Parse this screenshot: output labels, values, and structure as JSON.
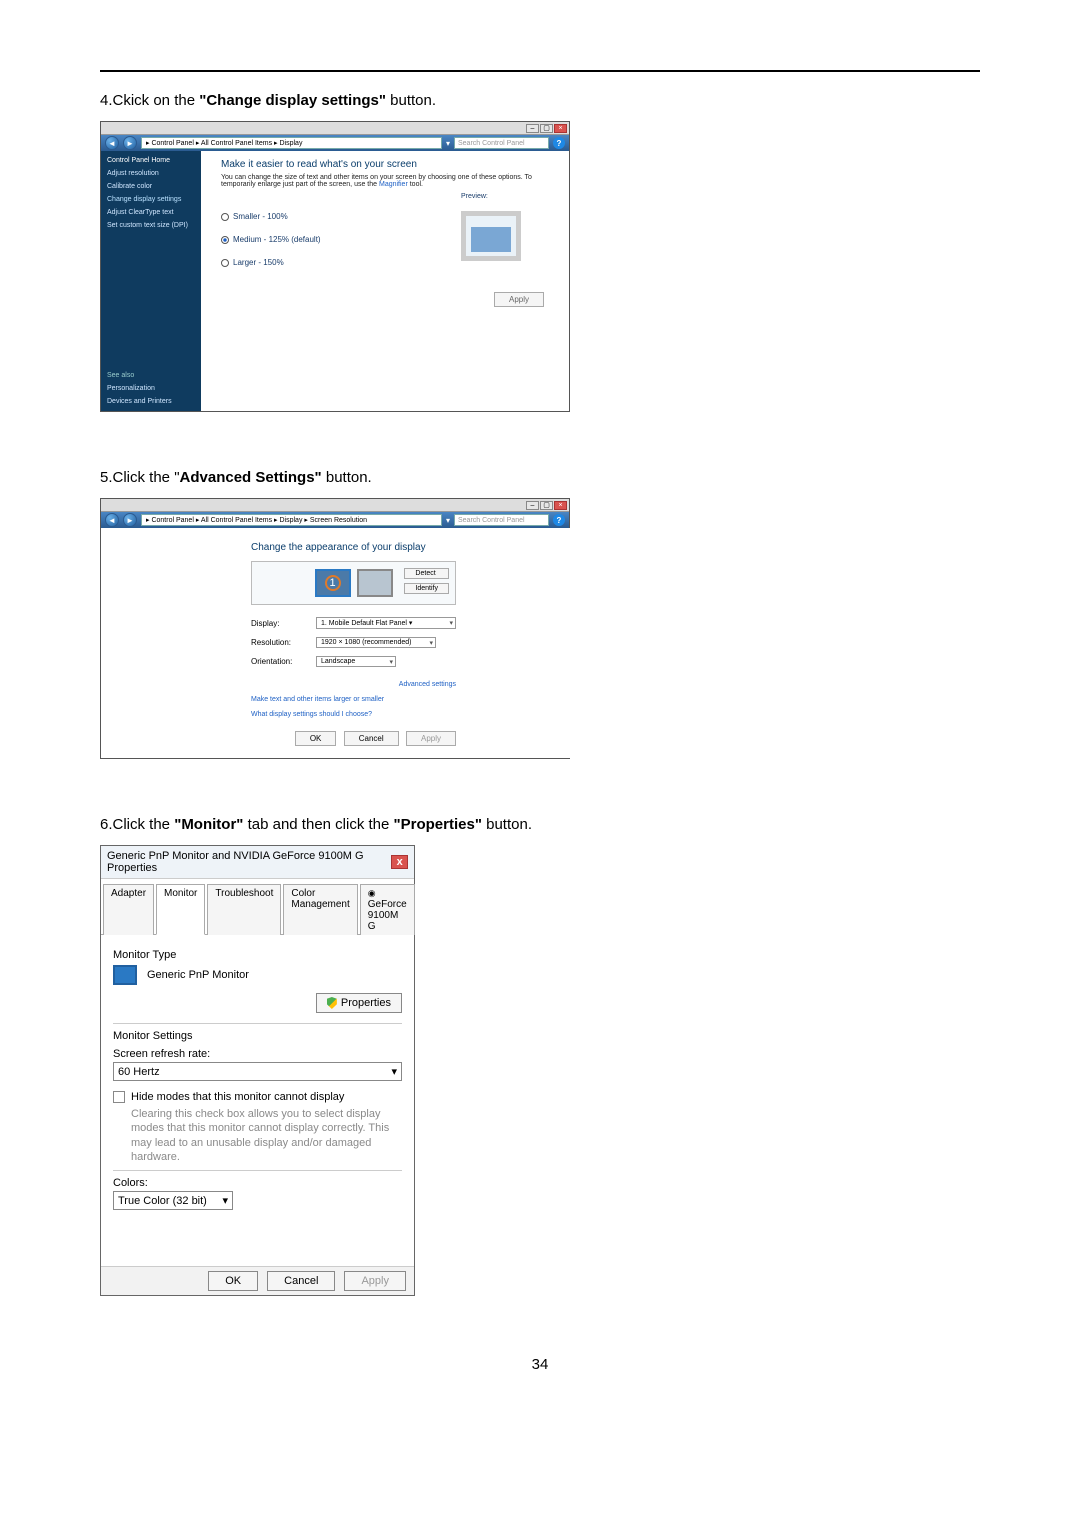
{
  "page_number": "34",
  "step4": {
    "instr_prefix": "4.Ckick on the ",
    "instr_bold": "\"Change display settings\"",
    "instr_suffix": " button.",
    "breadcrumb": "▸ Control Panel ▸ All Control Panel Items ▸ Display",
    "search_placeholder": "Search Control Panel",
    "sidebar": {
      "home": "Control Panel Home",
      "links": [
        "Adjust resolution",
        "Calibrate color",
        "Change display settings",
        "Adjust ClearType text",
        "Set custom text size (DPI)"
      ],
      "see_also": "See also",
      "personalization": "Personalization",
      "devices": "Devices and Printers"
    },
    "heading": "Make it easier to read what's on your screen",
    "desc_a": "You can change the size of text and other items on your screen by choosing one of these options. To temporarily enlarge just part of the screen, use the ",
    "desc_link": "Magnifier",
    "desc_b": " tool.",
    "options": [
      {
        "label": "Smaller - 100%",
        "selected": false
      },
      {
        "label": "Medium - 125% (default)",
        "selected": true
      },
      {
        "label": "Larger - 150%",
        "selected": false
      }
    ],
    "preview_label": "Preview:",
    "apply": "Apply"
  },
  "step5": {
    "instr_prefix": "5.Click the \"",
    "instr_bold": "Advanced Settings\"",
    "instr_suffix": " button.",
    "breadcrumb": "▸ Control Panel ▸ All Control Panel Items ▸ Display ▸ Screen Resolution",
    "search_placeholder": "Search Control Panel",
    "heading": "Change the appearance of your display",
    "detect": "Detect",
    "identify": "Identify",
    "rows": {
      "display_lbl": "Display:",
      "display_val": "1. Mobile Default Flat Panel   ▾",
      "res_lbl": "Resolution:",
      "res_val": "1920 × 1080 (recommended)",
      "orient_lbl": "Orientation:",
      "orient_val": "Landscape"
    },
    "adv": "Advanced settings",
    "help1": "Make text and other items larger or smaller",
    "help2": "What display settings should I choose?",
    "ok": "OK",
    "cancel": "Cancel",
    "apply": "Apply"
  },
  "step6": {
    "instr_prefix": "6.Click the ",
    "instr_bold1": "\"Monitor\"",
    "instr_mid": " tab and then click the ",
    "instr_bold2": "\"Properties\"",
    "instr_suffix": " button.",
    "title": "Generic PnP Monitor and NVIDIA GeForce 9100M G   Properties",
    "tabs": [
      "Adapter",
      "Monitor",
      "Troubleshoot",
      "Color Management",
      "GeForce 9100M G"
    ],
    "monitor_type_lbl": "Monitor Type",
    "monitor_name": "Generic PnP Monitor",
    "properties_btn": "Properties",
    "settings_lbl": "Monitor Settings",
    "refresh_lbl": "Screen refresh rate:",
    "refresh_val": "60 Hertz",
    "hide_modes": "Hide modes that this monitor cannot display",
    "hide_desc": "Clearing this check box allows you to select display modes that this monitor cannot display correctly. This may lead to an unusable display and/or damaged hardware.",
    "colors_lbl": "Colors:",
    "colors_val": "True Color (32 bit)",
    "ok": "OK",
    "cancel": "Cancel",
    "apply": "Apply"
  }
}
